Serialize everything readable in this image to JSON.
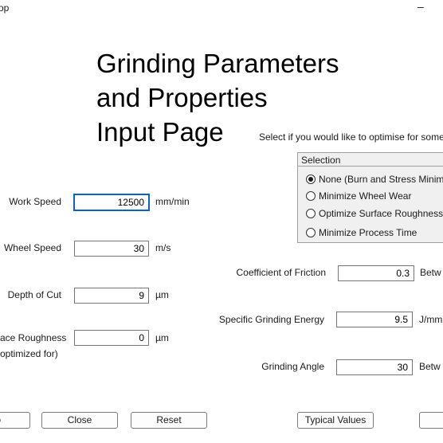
{
  "window": {
    "title_fragment": "op",
    "minimize_glyph": "–"
  },
  "page_title": {
    "line1": "Grinding Parameters",
    "line2": "and Properties",
    "line3": "Input Page"
  },
  "optimise_prompt": "Select if you would like to optimise for someth",
  "left_fields": {
    "work_speed": {
      "label": "Work Speed",
      "value": "12500",
      "unit": "mm/min"
    },
    "wheel_speed": {
      "label": "Wheel Speed",
      "value": "30",
      "unit": "m/s"
    },
    "depth_of_cut": {
      "label": "Depth of Cut",
      "value": "9",
      "unit": "µm"
    },
    "surface_roughness": {
      "label": "ace Roughness",
      "sublabel": "optimized for)",
      "value": "0",
      "unit": "µm"
    }
  },
  "right_fields": {
    "coefficient_of_friction": {
      "label": "Coefficient of Friction",
      "value": "0.3",
      "unit": "Betw"
    },
    "specific_grinding_energy": {
      "label": "Specific Grinding Energy",
      "value": "9.5",
      "unit": "J/mm"
    },
    "grinding_angle": {
      "label": "Grinding Angle",
      "value": "30",
      "unit": "Betw"
    }
  },
  "selection": {
    "title": "Selection",
    "options": [
      {
        "label": "None (Burn and Stress Minimi",
        "checked": true
      },
      {
        "label": "Minimize Wheel Wear",
        "checked": false
      },
      {
        "label": "Optimize Surface Roughness",
        "checked": false
      },
      {
        "label": "Minimize Process Time",
        "checked": false
      }
    ]
  },
  "buttons": {
    "partial_left": "o",
    "close": "Close",
    "reset": "Reset",
    "typical_values": "Typical Values"
  }
}
